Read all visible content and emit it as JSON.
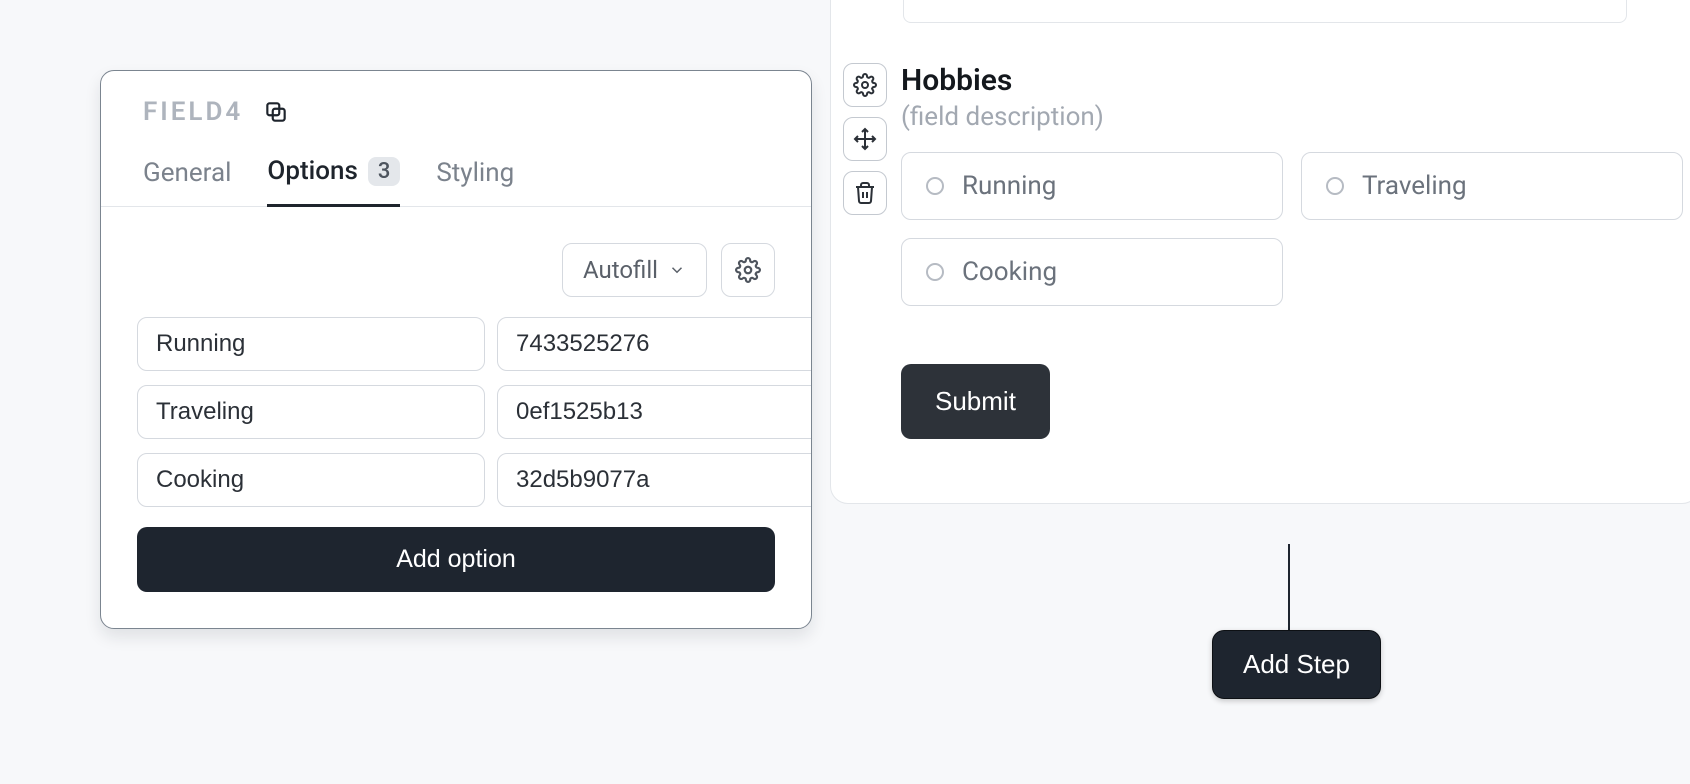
{
  "editor": {
    "fieldName": "FIELD4",
    "tabs": {
      "general": "General",
      "options": "Options",
      "optionsCount": "3",
      "styling": "Styling"
    },
    "toolbar": {
      "autofill": "Autofill"
    },
    "options": [
      {
        "label": "Running",
        "value": "7433525276",
        "color": "#77d88e"
      },
      {
        "label": "Traveling",
        "value": "0ef1525b13",
        "color": "#e4d97a"
      },
      {
        "label": "Cooking",
        "value": "32d5b9077a",
        "color": "#38c9f2"
      }
    ],
    "addOption": "Add option"
  },
  "preview": {
    "title": "Hobbies",
    "description": "(field description)",
    "options": [
      {
        "label": "Running"
      },
      {
        "label": "Traveling"
      },
      {
        "label": "Cooking"
      }
    ],
    "submit": "Submit"
  },
  "addStep": "Add Step"
}
